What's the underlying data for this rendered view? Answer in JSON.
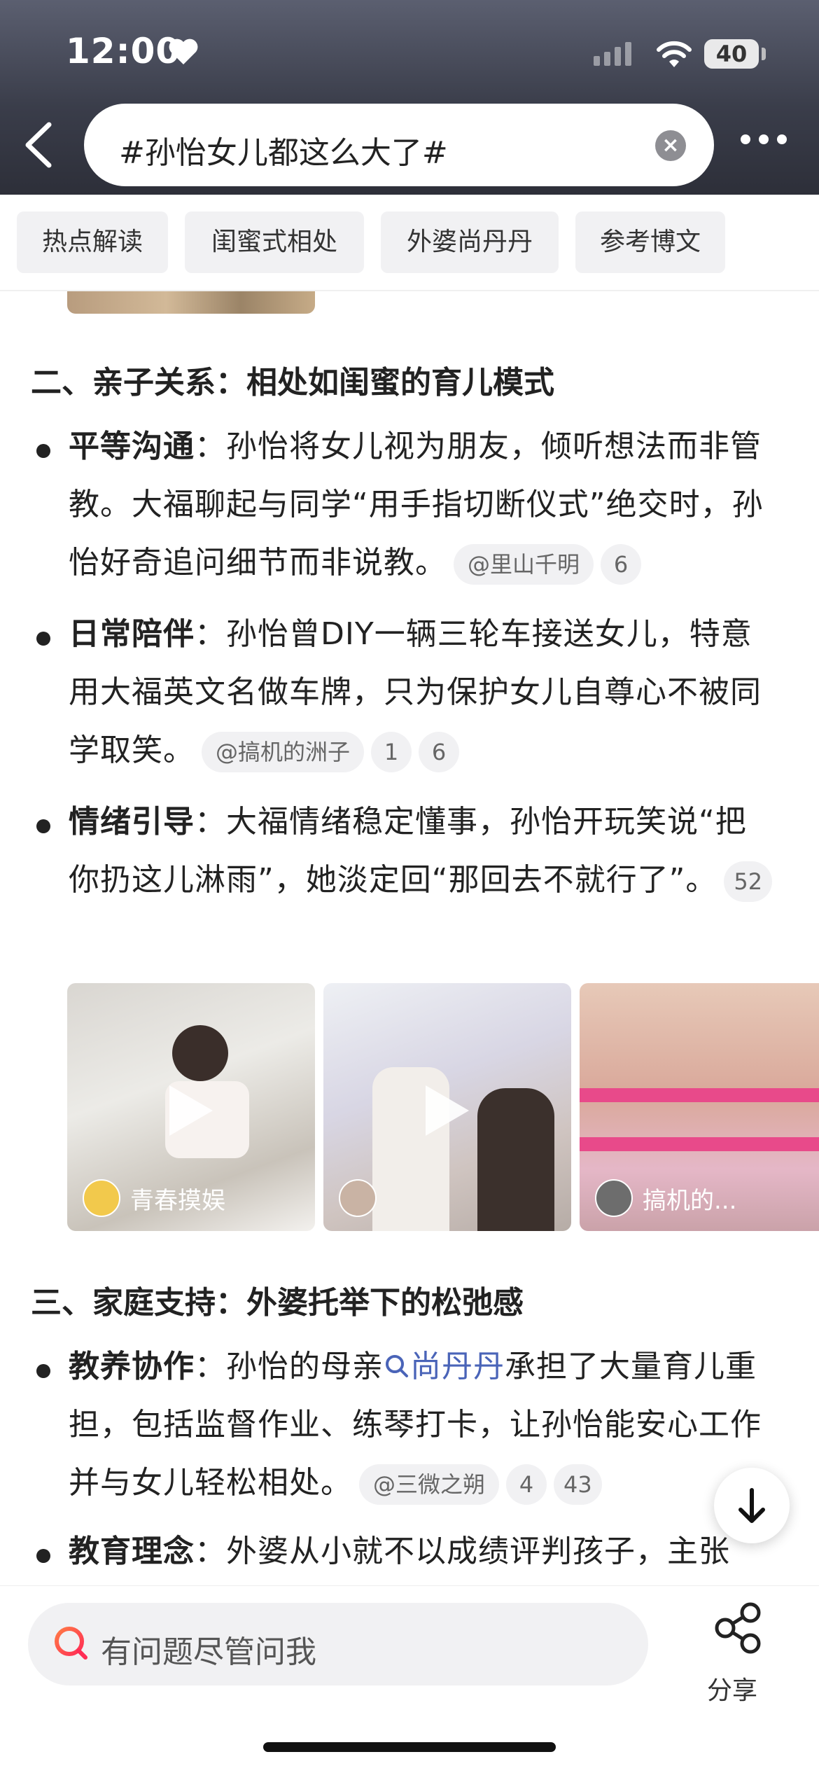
{
  "status_bar": {
    "time": "12:00",
    "battery": "40"
  },
  "search": {
    "query": "#孙怡女儿都这么大了#"
  },
  "tags": [
    "热点解读",
    "闺蜜式相处",
    "外婆尚丹丹",
    "参考博文"
  ],
  "section2": {
    "title": "二、亲子关系：相处如闺蜜的育儿模式",
    "items": [
      {
        "label": "平等沟通",
        "sep": "：",
        "text": "孙怡将女儿视为朋友，倾听想法而非管教。大福聊起与同学“用手指切断仪式”绝交时，孙怡好奇追问细节而非说教。",
        "cite": "@里山千明",
        "counts": [
          "6"
        ]
      },
      {
        "label": "日常陪伴",
        "sep": "：",
        "text": "孙怡曾DIY一辆三轮车接送女儿，特意用大福英文名做车牌，只为保护女儿自尊心不被同学取笑。",
        "cite": "@搞机的洲子",
        "counts": [
          "1",
          "6"
        ]
      },
      {
        "label": "情绪引导",
        "sep": "：",
        "text": "大福情绪稳定懂事，孙怡开玩笑说“把你扔这儿淋雨”，她淡定回“那回去不就行了”。",
        "counts": [
          "52"
        ]
      }
    ]
  },
  "videos": [
    {
      "author": "青春摸娱",
      "avatar_color": "#f2c94c"
    },
    {
      "author": "",
      "avatar_color": "#c9b3a4"
    },
    {
      "author": "搞机的...",
      "avatar_color": "#6d6d6d"
    }
  ],
  "section3": {
    "title": "三、家庭支持：外婆托举下的松弛感",
    "item1": {
      "label": "教养协作",
      "sep": "：",
      "pre": "孙怡的母亲",
      "link": "尚丹丹",
      "post": "承担了大量育儿重担，包括监督作业、练琴打卡，让孙怡能安心工作并与女儿轻松相处。",
      "cite": "@三微之朔",
      "counts": [
        "4",
        "43"
      ]
    },
    "item2": {
      "label": "教育理念",
      "sep": "：",
      "text": "外婆从小就不以成绩评判孩子，主张"
    }
  },
  "bottom": {
    "ask_placeholder": "有问题尽管问我",
    "share_label": "分享"
  },
  "colors": {
    "accent_link": "#4a64b8",
    "header_bg": "#3a3d4a",
    "chip_bg": "#f1f1f3"
  }
}
